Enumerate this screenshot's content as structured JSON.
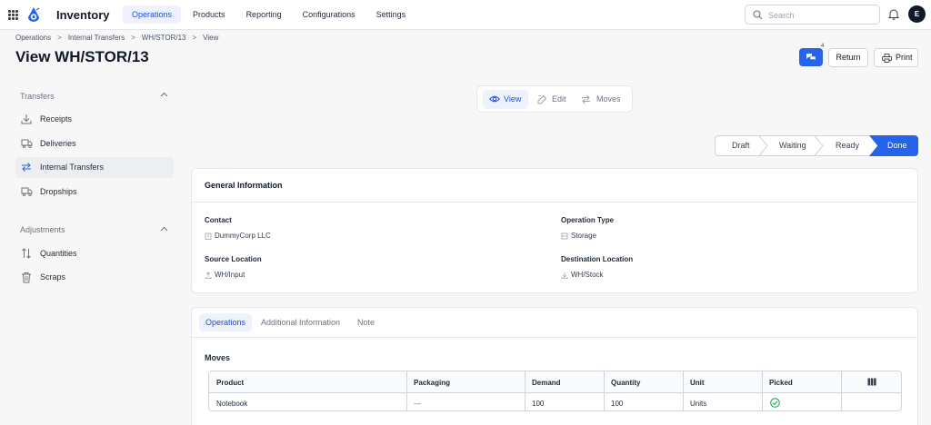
{
  "app": {
    "title": "Inventory",
    "nav": [
      "Operations",
      "Products",
      "Reporting",
      "Configurations",
      "Settings"
    ],
    "active_nav": "Operations",
    "search_placeholder": "Search",
    "avatar_initial": "E",
    "brand_color": "#2563eb"
  },
  "header": {
    "breadcrumb": [
      "Operations",
      "Internal Transfers",
      "WH/STOR/13",
      "View"
    ],
    "title": "View WH/STOR/13",
    "chat_count": "4",
    "return_label": "Return",
    "print_label": "Print"
  },
  "sidebar": {
    "sections": [
      {
        "label": "Transfers",
        "items": [
          {
            "label": "Receipts",
            "icon": "receipt-download-icon"
          },
          {
            "label": "Deliveries",
            "icon": "truck-icon"
          },
          {
            "label": "Internal Transfers",
            "icon": "transfer-arrows-icon",
            "active": true
          },
          {
            "label": "Dropships",
            "icon": "truck-icon"
          }
        ]
      },
      {
        "label": "Adjustments",
        "items": [
          {
            "label": "Quantities",
            "icon": "sort-arrows-icon"
          },
          {
            "label": "Scraps",
            "icon": "trash-icon"
          }
        ]
      }
    ]
  },
  "view_switch": {
    "items": [
      {
        "label": "View",
        "icon": "eye-icon",
        "active": true
      },
      {
        "label": "Edit",
        "icon": "pencil-icon"
      },
      {
        "label": "Moves",
        "icon": "transfer-arrows-icon"
      }
    ]
  },
  "pipeline": {
    "stages": [
      "Draft",
      "Waiting",
      "Ready",
      "Done"
    ],
    "current": "Done"
  },
  "general": {
    "title": "General Information",
    "fields": [
      {
        "label": "Contact",
        "value": "DummyCorp LLC",
        "icon": "building-icon"
      },
      {
        "label": "Operation Type",
        "value": "Storage",
        "icon": "storage-icon"
      },
      {
        "label": "Source Location",
        "value": "WH/Input",
        "icon": "upload-icon"
      },
      {
        "label": "Destination Location",
        "value": "WH/Stock",
        "icon": "download-icon"
      }
    ]
  },
  "operations": {
    "tabs": [
      "Operations",
      "Additional Information",
      "Note"
    ],
    "active_tab": "Operations",
    "moves_label": "Moves",
    "columns": [
      "Product",
      "Packaging",
      "Demand",
      "Quantity",
      "Unit",
      "Picked"
    ],
    "rows": [
      {
        "product": "Notebook",
        "packaging": "—",
        "demand": "100",
        "quantity": "100",
        "unit": "Units",
        "picked": true
      }
    ]
  }
}
